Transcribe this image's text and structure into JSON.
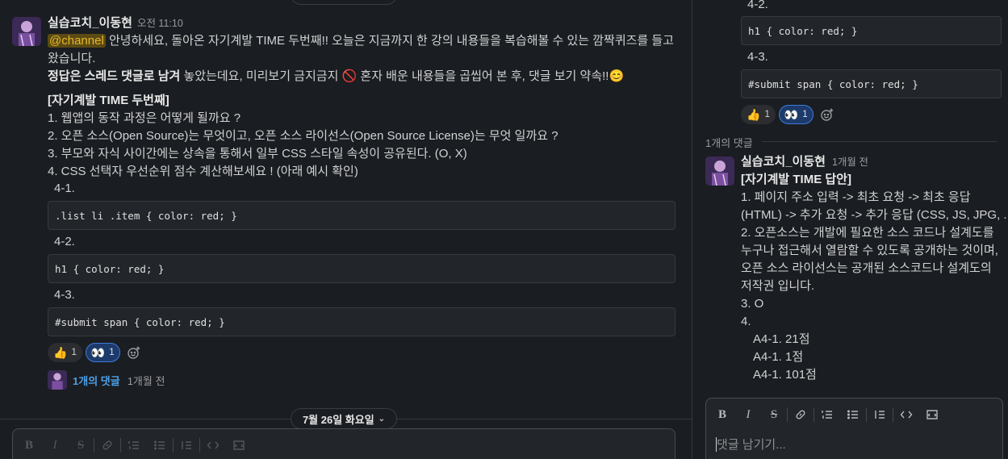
{
  "main": {
    "message": {
      "author": "실습코치_이동현",
      "time": "오전 11:10",
      "mention": "@channel",
      "line1_rest": " 안녕하세요, 돌아온 자기계발 TIME 두번째!! 오늘은 지금까지 한 강의 내용들을 복습해볼 수 있는 깜짝퀴즈를 들고",
      "line2": "왔습니다.",
      "line3_bold": "정답은 스레드 댓글로 남겨",
      "line3_rest": " 놓았는데요, 미리보기 금지금지 ",
      "line3_emoji": "🚫",
      "line3_tail": " 혼자 배운 내용들을 곱씹어 본 후, 댓글 보기 약속!!",
      "line3_smile": "😊",
      "quiz_title": "[자기계발 TIME 두번째]",
      "questions": [
        "1. 웹앱의 동작 과정은 어떻게 될까요 ?",
        "2. 오픈 소스(Open Source)는 무엇이고, 오픈 소스 라이선스(Open Source License)는 무엇 일까요 ?",
        "3. 부모와 자식 사이간에는 상속을 통해서 일부 CSS 스타일 속성이 공유된다. (O, X)",
        "4. CSS 선택자 우선순위 점수 계산해보세요 ! (아래 예시 확인)"
      ],
      "examples": [
        {
          "label": "4-1.",
          "code": ".list li .item { color: red; }"
        },
        {
          "label": "4-2.",
          "code": "h1 { color: red; }"
        },
        {
          "label": "4-3.",
          "code": "#submit span { color: red; }"
        }
      ],
      "reactions": [
        {
          "emoji": "👍",
          "count": "1"
        },
        {
          "emoji": "👀",
          "count": "1"
        }
      ],
      "replies_link": "1개의 댓글",
      "replies_time": "1개월 전"
    },
    "date_divider": "7월 26일 화요일"
  },
  "thread": {
    "top_examples": [
      {
        "label": "4-2.",
        "code": "h1 { color: red; }"
      },
      {
        "label": "4-3.",
        "code": "#submit span { color: red; }"
      }
    ],
    "reactions": [
      {
        "emoji": "👍",
        "count": "1"
      },
      {
        "emoji": "👀",
        "count": "1"
      }
    ],
    "reply_count": "1개의 댓글",
    "reply": {
      "author": "실습코치_이동현",
      "time": "1개월 전",
      "title": "[자기계발 TIME 답안]",
      "lines": [
        "1. 페이지 주소 입력 -> 최초 요청 -> 최초 응답",
        "(HTML) -> 추가 요청 -> 추가 응답 (CSS, JS, JPG, ...)",
        "2. 오픈소스는 개발에 필요한 소스 코드나 설계도를",
        "누구나 접근해서 열람할 수 있도록 공개하는 것이며,",
        "오픈 소스 라이선스는 공개된 소스코드나 설계도의",
        "저작권 입니다.",
        "3. O",
        "4.",
        "A4-1. 21점",
        "A4-1. 1점",
        "A4-1. 101점"
      ]
    },
    "composer_placeholder": "댓글 남기기..."
  },
  "icons": {
    "bold": "bold-icon",
    "italic": "italic-icon",
    "strike": "strikethrough-icon",
    "link": "link-icon",
    "ordered": "ordered-list-icon",
    "bullet": "bullet-list-icon",
    "quote": "blockquote-icon",
    "code": "code-icon",
    "codeblock": "code-block-icon",
    "add_reaction": "add-reaction-icon",
    "chevron": "chevron-down-icon"
  },
  "colors": {
    "background": "#1a1d21",
    "mention_bg": "#5b4a13",
    "mention_fg": "#e8b829",
    "link": "#4da0e8",
    "reaction_active": "#1d3a6b"
  }
}
